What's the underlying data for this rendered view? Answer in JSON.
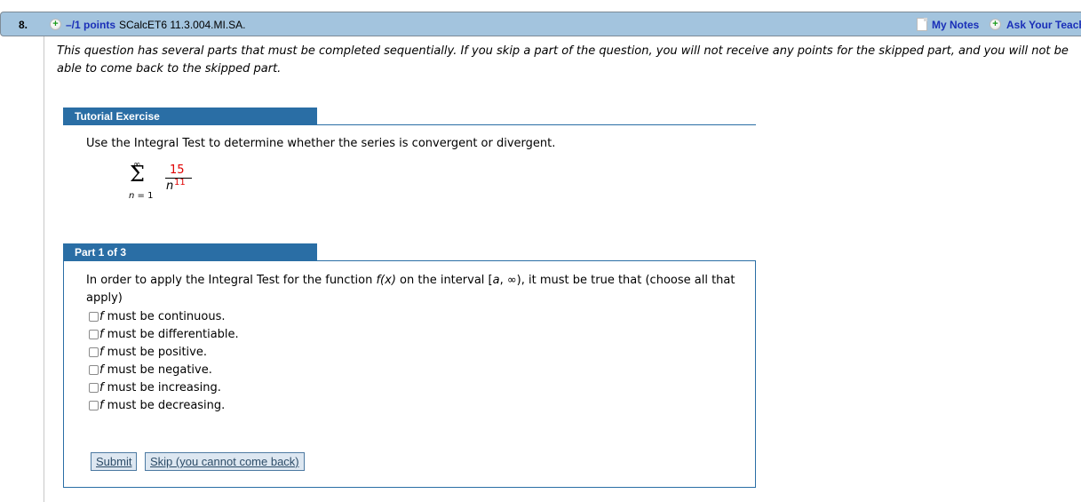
{
  "header": {
    "question_number": "8.",
    "points_label": "–/1 points",
    "question_code": "SCalcET6 11.3.004.MI.SA.",
    "my_notes_label": "My Notes",
    "ask_teacher_label": "Ask Your Teacher",
    "icons": {
      "points": "plus-circle-icon",
      "notes": "note-page-icon",
      "ask": "plus-circle-icon"
    }
  },
  "intro": "This question has several parts that must be completed sequentially. If you skip a part of the question, you will not receive any points for the skipped part, and you will not be able to come back to the skipped part.",
  "tutorial": {
    "title": "Tutorial Exercise",
    "instruction": "Use the Integral Test to determine whether the series is convergent or divergent.",
    "series": {
      "upper_limit": "∞",
      "sigma": "Σ",
      "lower_limit_var": "n",
      "lower_limit_rest": " = 1",
      "numerator": "15",
      "denominator_base": "n",
      "denominator_exponent": "11",
      "highlight_color": "#e00000"
    }
  },
  "part": {
    "title": "Part 1 of 3",
    "question_prefix": "In order to apply the Integral Test for the function ",
    "question_func": "f(x)",
    "question_mid": " on the interval [",
    "question_a": "a",
    "question_suffix": ", ∞), it must be true that (choose all that apply)",
    "options": [
      {
        "var": "f",
        "text": "must be continuous.",
        "checked": false
      },
      {
        "var": "f",
        "text": "must be differentiable.",
        "checked": false
      },
      {
        "var": "f",
        "text": "must be positive.",
        "checked": false
      },
      {
        "var": "f",
        "text": "must be negative.",
        "checked": false
      },
      {
        "var": "f",
        "text": "must be increasing.",
        "checked": false
      },
      {
        "var": "f",
        "text": "must be decreasing.",
        "checked": false
      }
    ],
    "submit_label": "Submit",
    "skip_label": "Skip (you cannot come back)"
  },
  "colors": {
    "header_bg": "#a3c4de",
    "section_blue": "#2a6ea5",
    "link_blue": "#1a2fb8"
  }
}
